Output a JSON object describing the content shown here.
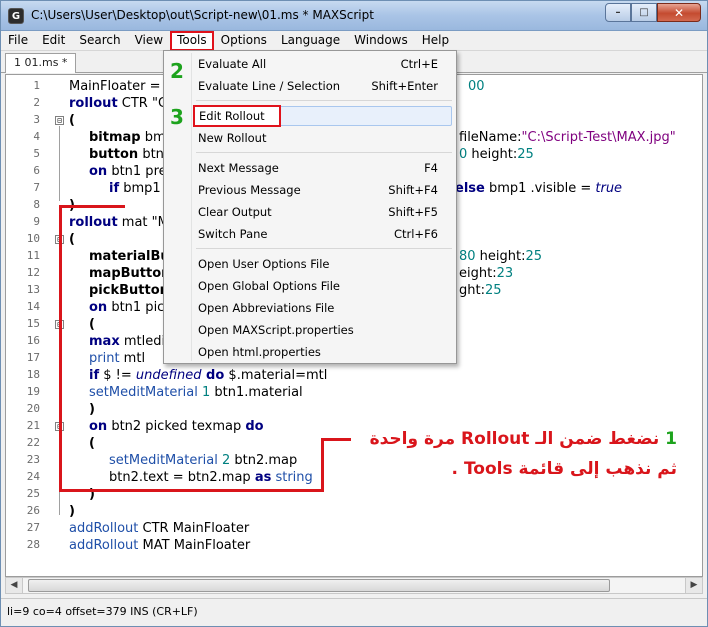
{
  "window": {
    "title": "C:\\Users\\User\\Desktop\\out\\Script-new\\01.ms * MAXScript",
    "app_icon": "G",
    "minimize": "–",
    "maximize": "□",
    "close": "✕"
  },
  "menu": [
    "File",
    "Edit",
    "Search",
    "View",
    "Tools",
    "Options",
    "Language",
    "Windows",
    "Help"
  ],
  "tab": {
    "label": "1 01.ms *"
  },
  "line_numbers": [
    "1",
    "2",
    "3",
    "4",
    "5",
    "6",
    "7",
    "8",
    "9",
    "10",
    "11",
    "12",
    "13",
    "14",
    "15",
    "16",
    "17",
    "18",
    "19",
    "20",
    "21",
    "22",
    "23",
    "24",
    "25",
    "26",
    "27",
    "28"
  ],
  "code": {
    "l1": "MainFloater =",
    "l1_tail": "00",
    "l2_kw": "rollout",
    "l2": " CTR \"C",
    "l3": "(",
    "l4_kw": "bitmap",
    "l4": " bm",
    "l4_tail_a": "fileName:",
    "l4_tail_b": "\"C:\\Script-Test\\MAX.jpg\"",
    "l5_kw": "button",
    "l5": " btn",
    "l5_tail_a": "0",
    "l5_tail_b": " height:",
    "l5_tail_c": "25",
    "l6_kw": "on",
    "l6": " btn1 pre",
    "l7_kw": "if",
    "l7": " bmp1",
    "l7_tail_kw": "else",
    "l7_tail": " bmp1 .visible = ",
    "l7_tail_true": "true",
    "l8": ")",
    "l9_kw": "rollout",
    "l9": " mat \"M",
    "l10": "(",
    "l11_kw": "materialBu",
    "l11_tail_a": "80",
    "l11_tail_b": " height:",
    "l11_tail_c": "25",
    "l12_kw": "mapButtor",
    "l12_tail_a": "eight:",
    "l12_tail_b": "23",
    "l13_kw": "pickButtor",
    "l13_tail_a": "ght:",
    "l13_tail_b": "25",
    "l14_kw": "on",
    "l14": " btn1 pic",
    "l15": "(",
    "l16_kw": "max",
    "l16": " mtledi",
    "l17_fn": "print",
    "l17": " mtl",
    "l18_kw": "if",
    "l18_a": " $ != ",
    "l18_und": "undefined",
    "l18_do": " do",
    "l18_b": " $.material=mtl",
    "l19_fn": "setMeditMaterial",
    "l19_num": " 1",
    "l19": " btn1.material",
    "l20": ")",
    "l21_kw": "on",
    "l21": " btn2 picked texmap ",
    "l21_do": "do",
    "l22": "(",
    "l23_fn": "setMeditMaterial",
    "l23_num": " 2",
    "l23": " btn2.map",
    "l24": "btn2.text = btn2.map ",
    "l24_as": "as",
    "l24_str": " string",
    "l25": ")",
    "l26": ")",
    "l27_fn": "addRollout",
    "l27": " CTR MainFloater",
    "l28_fn": "addRollout",
    "l28": " MAT MainFloater"
  },
  "dropdown": {
    "items": [
      {
        "label": "Evaluate All",
        "shortcut": "Ctrl+E"
      },
      {
        "label": "Evaluate Line / Selection",
        "shortcut": "Shift+Enter"
      },
      {
        "label": "Edit Rollout",
        "shortcut": ""
      },
      {
        "label": "New Rollout",
        "shortcut": ""
      },
      {
        "label": "Next Message",
        "shortcut": "F4"
      },
      {
        "label": "Previous Message",
        "shortcut": "Shift+F4"
      },
      {
        "label": "Clear Output",
        "shortcut": "Shift+F5"
      },
      {
        "label": "Switch Pane",
        "shortcut": "Ctrl+F6"
      },
      {
        "label": "Open User Options File",
        "shortcut": ""
      },
      {
        "label": "Open Global Options File",
        "shortcut": ""
      },
      {
        "label": "Open Abbreviations File",
        "shortcut": ""
      },
      {
        "label": "Open MAXScript.properties",
        "shortcut": ""
      },
      {
        "label": "Open html.properties",
        "shortcut": ""
      }
    ]
  },
  "steps": {
    "s1": "1",
    "s2": "2",
    "s3": "3"
  },
  "annotation": {
    "line1_a": "نضغط ضمن الـ",
    "line1_en": "Rollout",
    "line1_b": "مرة واحدة",
    "line2_a": "ثم نذهب إلى قائمة",
    "line2_en": "Tools",
    "line2_b": "."
  },
  "status": "li=9 co=4 offset=379 INS (CR+LF)",
  "scroll": {
    "left": "◀",
    "right": "▶"
  },
  "fold_glyph": "⊟",
  "colors": {
    "accent_red": "#e0121b",
    "step_green": "#1da31d"
  }
}
